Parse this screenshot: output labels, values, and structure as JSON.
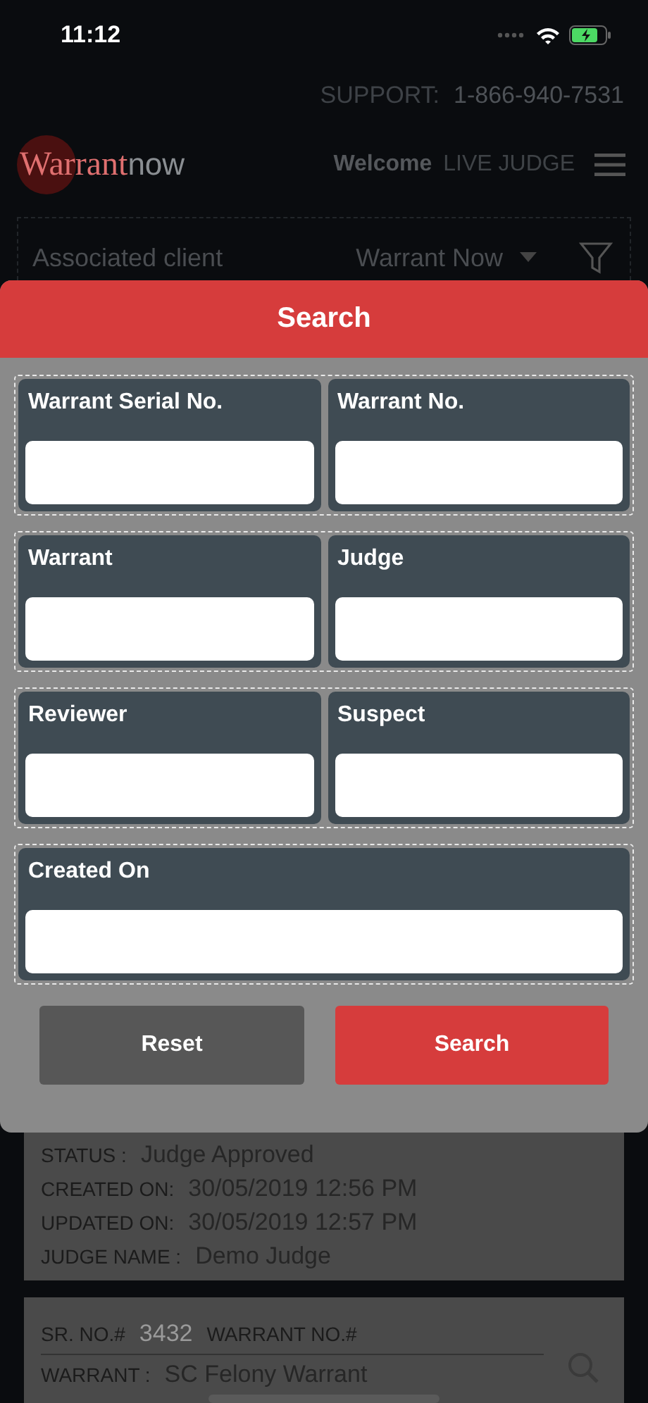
{
  "status_bar": {
    "time": "11:12"
  },
  "support": {
    "label": "SUPPORT:",
    "phone": "1-866-940-7531"
  },
  "header": {
    "logo": {
      "first": "Warrant",
      "second": "now"
    },
    "welcome": "Welcome",
    "user": "LIVE JUDGE"
  },
  "client_filter": {
    "label": "Associated client",
    "value": "Warrant Now"
  },
  "search_modal": {
    "title": "Search",
    "groups": [
      {
        "fields": [
          {
            "label": "Warrant Serial No."
          },
          {
            "label": "Warrant No."
          }
        ]
      },
      {
        "fields": [
          {
            "label": "Warrant"
          },
          {
            "label": "Judge"
          }
        ]
      },
      {
        "fields": [
          {
            "label": "Reviewer"
          },
          {
            "label": "Suspect"
          }
        ]
      },
      {
        "fields": [
          {
            "label": "Created On"
          }
        ]
      }
    ],
    "buttons": [
      {
        "label": "Reset",
        "kind": "secondary"
      },
      {
        "label": "Search",
        "kind": "primary"
      }
    ]
  },
  "warrant_cards": [
    {
      "fields": [
        {
          "label": "STATUS :",
          "value": "Judge Approved"
        },
        {
          "label": "CREATED ON:",
          "value": "30/05/2019 12:56 PM"
        },
        {
          "label": "UPDATED ON:",
          "value": "30/05/2019 12:57 PM"
        },
        {
          "label": "JUDGE NAME :",
          "value": "Demo Judge"
        }
      ]
    },
    {
      "sr_label": "SR. NO.#",
      "sr_value": "3432",
      "warrant_no_label": "WARRANT NO.#",
      "fields": [
        {
          "label": "WARRANT :",
          "value": "SC Felony Warrant"
        }
      ]
    }
  ]
}
